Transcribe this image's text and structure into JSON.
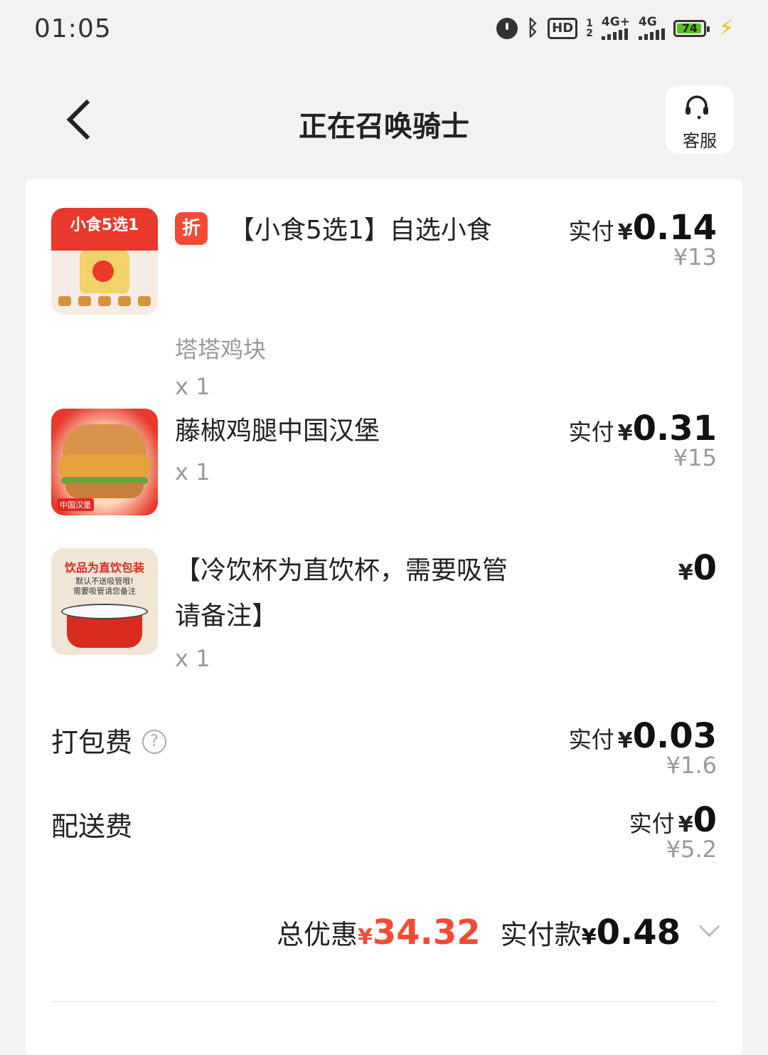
{
  "status_bar": {
    "time": "01:05",
    "hd_label": "HD",
    "sim1": "1",
    "sim2": "2",
    "net1": "4G+",
    "net2": "4G",
    "battery": "74"
  },
  "header": {
    "title": "正在召唤骑士",
    "service_label": "客服"
  },
  "items": [
    {
      "thumb_title": "小食5选1",
      "badge": "折",
      "name": "【小食5选1】自选小食",
      "spec": "塔塔鸡块",
      "qty": "x 1",
      "paid_label": "实付",
      "paid_yen": "¥",
      "paid_value": "0.14",
      "original": "¥13"
    },
    {
      "thumb_tag": "中国汉堡",
      "name": "藤椒鸡腿中国汉堡",
      "qty": "x 1",
      "paid_label": "实付",
      "paid_yen": "¥",
      "paid_value": "0.31",
      "original": "¥15"
    },
    {
      "thumb_title": "饮品为直饮包装",
      "thumb_sub1": "默认不送吸管哦!",
      "thumb_sub2": "需要吸管请您备注",
      "name": "【冷饮杯为直饮杯，需要吸管请备注】",
      "qty": "x 1",
      "paid_yen": "¥",
      "paid_value": "0"
    }
  ],
  "fees": {
    "packing": {
      "label": "打包费",
      "help_icon": "?",
      "paid_label": "实付",
      "paid_yen": "¥",
      "paid_value": "0.03",
      "original": "¥1.6"
    },
    "delivery": {
      "label": "配送费",
      "paid_label": "实付",
      "paid_yen": "¥",
      "paid_value": "0",
      "original": "¥5.2"
    }
  },
  "summary": {
    "discount_label": "总优惠",
    "discount_yen": "¥",
    "discount_value": "34.32",
    "paid_label": "实付款",
    "paid_yen": "¥",
    "paid_value": "0.48"
  },
  "colors": {
    "accent_red": "#f44a34",
    "background": "#f2f2f2",
    "card": "#ffffff"
  }
}
